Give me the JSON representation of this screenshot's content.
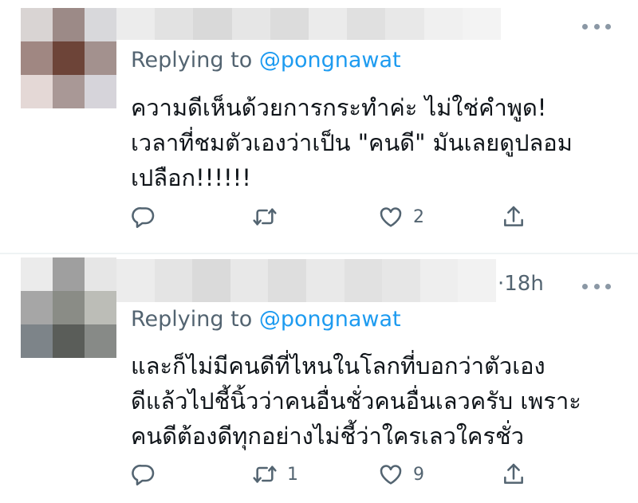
{
  "colors": {
    "accent": "#1d9bf0",
    "secondary_text": "#536471",
    "icon": "#536471"
  },
  "tweets": [
    {
      "replying_prefix": "Replying to ",
      "replying_handle": "@pongnawat",
      "timestamp": "",
      "text": "ความดีเห็นด้วยการกระทำค่ะ ไม่ใช่คำพูด!\nเวลาที่ชมตัวเองว่าเป็น \"คนดี\" มันเลยดูปลอม\nเปลือก!!!!!!",
      "actions": {
        "reply_count": "",
        "retweet_count": "",
        "like_count": "2"
      },
      "icons": [
        "reply-icon",
        "retweet-icon",
        "like-icon",
        "share-icon",
        "more-options-icon"
      ]
    },
    {
      "replying_prefix": "Replying to ",
      "replying_handle": "@pongnawat",
      "timestamp": "·18h",
      "text": "และก็ไม่มีคนดีที่ไหนในโลกที่บอกว่าตัวเอง\nดีแล้วไปชี้นิ้วว่าคนอื่นชั่วคนอื่นเลวครับ  เพราะ\nคนดีต้องดีทุกอย่างไม่ชี้ว่าใครเลวใครชั่ว",
      "actions": {
        "reply_count": "",
        "retweet_count": "1",
        "like_count": "9"
      },
      "icons": [
        "reply-icon",
        "retweet-icon",
        "like-icon",
        "share-icon",
        "more-options-icon"
      ]
    }
  ]
}
